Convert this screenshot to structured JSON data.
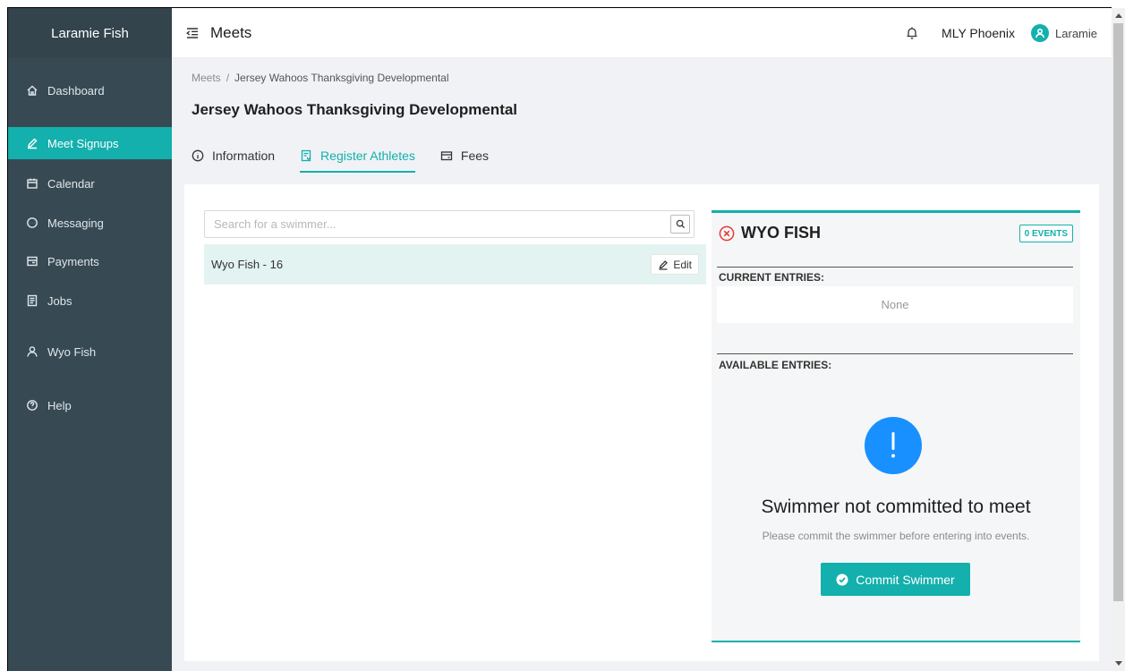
{
  "app": {
    "name": "Laramie Fish"
  },
  "sidebar": {
    "items": [
      {
        "label": "Dashboard",
        "icon": "home-icon"
      },
      {
        "label": "Meet Signups",
        "icon": "edit-icon",
        "active": true
      },
      {
        "label": "Calendar",
        "icon": "calendar-icon"
      },
      {
        "label": "Messaging",
        "icon": "message-icon"
      },
      {
        "label": "Payments",
        "icon": "payment-icon"
      },
      {
        "label": "Jobs",
        "icon": "jobs-icon"
      },
      {
        "label": "Wyo Fish",
        "icon": "user-icon"
      },
      {
        "label": "Help",
        "icon": "help-icon"
      }
    ]
  },
  "header": {
    "title": "Meets",
    "team": "MLY Phoenix",
    "user": "Laramie"
  },
  "breadcrumb": {
    "root": "Meets",
    "separator": "/",
    "current": "Jersey Wahoos Thanksgiving Developmental"
  },
  "page": {
    "title": "Jersey Wahoos Thanksgiving Developmental"
  },
  "tabs": [
    {
      "label": "Information",
      "icon": "info-icon"
    },
    {
      "label": "Register Athletes",
      "icon": "register-icon",
      "active": true
    },
    {
      "label": "Fees",
      "icon": "fees-icon"
    }
  ],
  "search": {
    "placeholder": "Search for a swimmer...",
    "value": ""
  },
  "swimmers": [
    {
      "name": "Wyo Fish - 16",
      "edit_label": "Edit",
      "selected": true
    }
  ],
  "panel": {
    "name": "WYO FISH",
    "events_badge": "0 EVENTS",
    "current_label": "CURRENT ENTRIES:",
    "current_empty": "None",
    "available_label": "AVAILABLE ENTRIES:",
    "message_title": "Swimmer not committed to meet",
    "message_sub": "Please commit the swimmer before entering into events.",
    "commit_label": "Commit Swimmer"
  },
  "colors": {
    "accent": "#13b0ad",
    "sidebar_bg": "#374a54",
    "info_blue": "#1890ff",
    "error_red": "#e53935"
  }
}
